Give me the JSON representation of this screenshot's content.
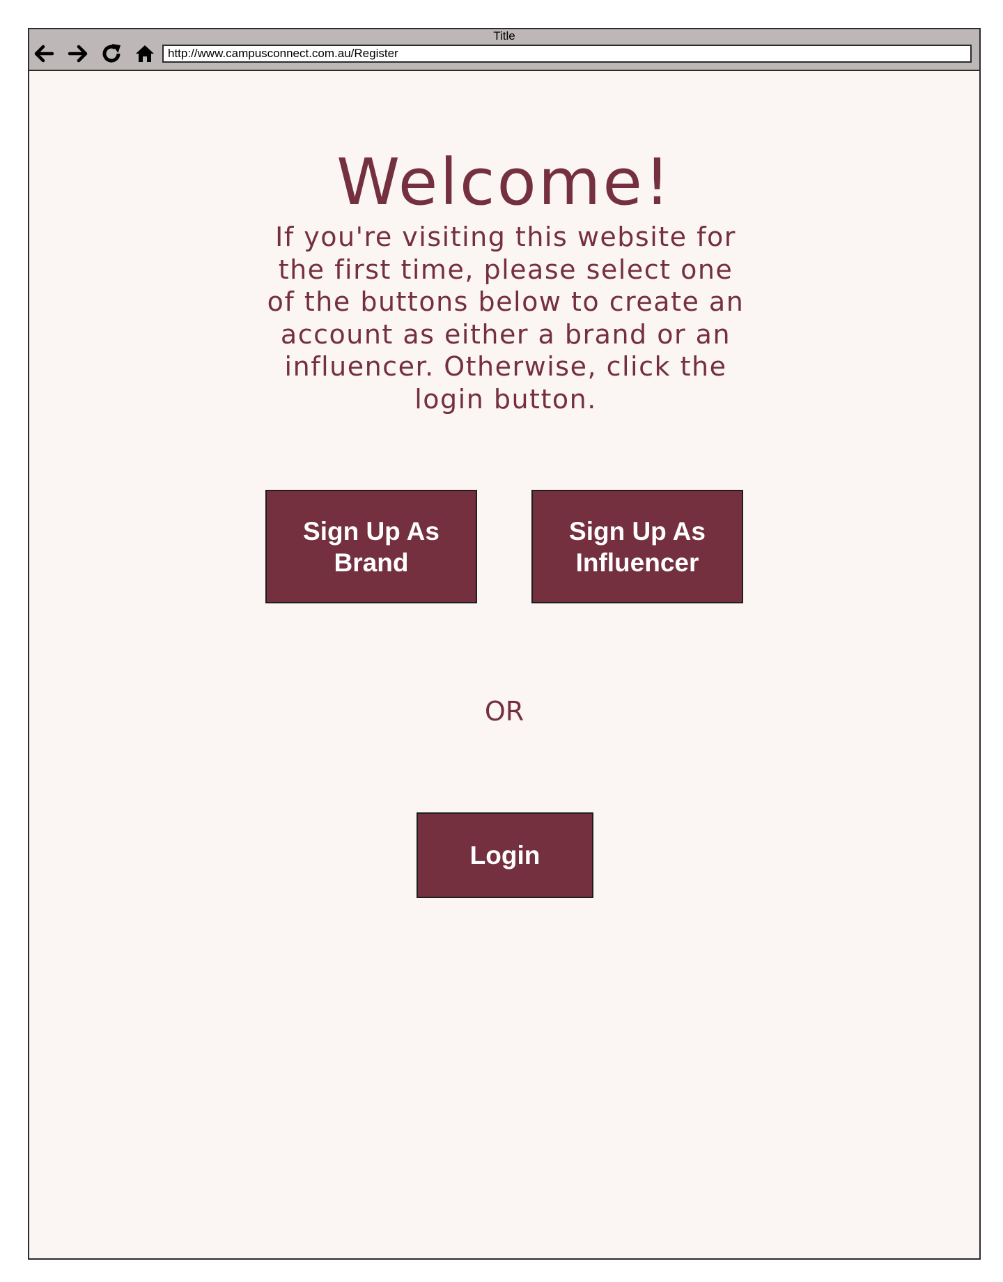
{
  "browser": {
    "title": "Title",
    "url": "http://www.campusconnect.com.au/Register",
    "nav_icons": [
      "back-arrow-icon",
      "forward-arrow-icon",
      "refresh-icon",
      "home-icon"
    ]
  },
  "page": {
    "heading": "Welcome!",
    "intro": "If you're visiting this website for the first time, please select one of the buttons below to create an account as either a brand or an influencer. Otherwise, click the login button.",
    "signup_brand_label": "Sign Up As Brand",
    "signup_influencer_label": "Sign Up As Influencer",
    "or_text": "OR",
    "login_label": "Login"
  },
  "colors": {
    "accent": "#75303f",
    "page_background": "#fbf5f4",
    "toolbar": "#bdb7b7"
  }
}
